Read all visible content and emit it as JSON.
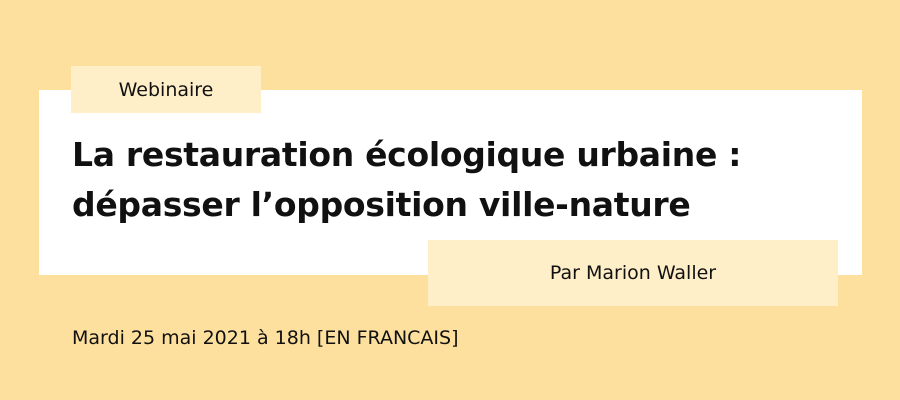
{
  "tag": "Webinaire",
  "title_line1": "La restauration écologique urbaine :",
  "title_line2": "dépasser l’opposition ville-nature",
  "author": "Par Marion Waller",
  "date": "Mardi 25 mai 2021 à 18h [EN FRANCAIS]",
  "colors": {
    "background": "#fde09e",
    "card": "#ffffff",
    "label": "#feefc9"
  }
}
